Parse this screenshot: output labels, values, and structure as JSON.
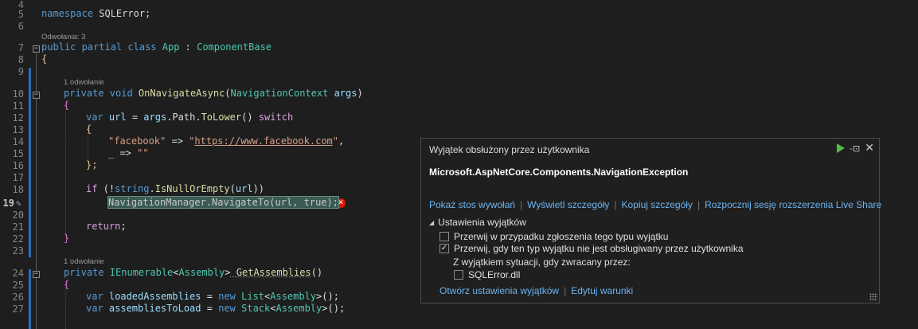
{
  "editor": {
    "line_numbers": [
      "4",
      "5",
      "6",
      "7",
      "8",
      "9",
      "10",
      "11",
      "12",
      "13",
      "14",
      "15",
      "16",
      "17",
      "18",
      "19",
      "20",
      "21",
      "22",
      "23",
      "24",
      "25",
      "26",
      "27"
    ],
    "lens_refs_3": "Odwołania: 3",
    "lens_ref_1a": "1 odwołanie",
    "lens_ref_1b": "1 odwołanie",
    "l5": {
      "kw": "namespace",
      "name": " SQLError;"
    },
    "l7": {
      "kw1": "public",
      "kw2": " partial",
      "kw3": " class",
      "type": " App",
      "sep": " : ",
      "base": "ComponentBase"
    },
    "l8": "{",
    "l10": {
      "kw1": "private",
      "kw2": " void",
      "fn": " OnNavigateAsync",
      "p1": "(",
      "type": "NavigationContext",
      "arg": " args",
      "p2": ")"
    },
    "l11": "{",
    "l12": {
      "kw": "var",
      "v": " url",
      "eq": " = ",
      "args": "args",
      "dot": ".",
      "path": "Path",
      "dot2": ".",
      "fn": "ToLower",
      "par": "()",
      "sw": " switch"
    },
    "l13": "{",
    "l14": {
      "s1": "\"facebook\"",
      "arrow": " => ",
      "q1": "\"",
      "url": "https://www.facebook.com",
      "q2": "\"",
      "comma": ","
    },
    "l15": {
      "disc": "_",
      "arrow": " => ",
      "s": "\"\""
    },
    "l16": "};",
    "l18": {
      "kw": "if",
      "p": " (!",
      "kw2": "string",
      "dot": ".",
      "fn": "IsNullOrEmpty",
      "p2": "(",
      "v": "url",
      "p3": "))"
    },
    "l19": "NavigationManager.NavigateTo(url, true);",
    "l21": {
      "kw": "return",
      "semi": ";"
    },
    "l22": "}",
    "l24": {
      "kw": "private",
      "type": " IEnumerable",
      "lt": "<",
      "t2": "Assembly",
      "gt": ">",
      "fn": " GetAssemblies",
      "par": "()"
    },
    "l25": "{",
    "l26": {
      "kw": "var",
      "v": " loadedAssemblies",
      "eq": " = ",
      "new": "new",
      "type": " List",
      "lt": "<",
      "t2": "Assembly",
      "gt": ">",
      "par": "();"
    },
    "l27": {
      "kw": "var",
      "v": " assembliesToLoad",
      "eq": " = ",
      "new": "new",
      "type": " Stack",
      "lt": "<",
      "t2": "Assembly",
      "gt": ">",
      "par": "();"
    }
  },
  "popup": {
    "title": "Wyjątek obsłużony przez użytkownika",
    "exception": "Microsoft.AspNetCore.Components.NavigationException",
    "links": [
      "Pokaż stos wywołań",
      "Wyświetl szczegóły",
      "Kopiuj szczegóły",
      "Rozpocznij sesję rozszerzenia Live Share"
    ],
    "section": "Ustawienia wyjątków",
    "opt1": {
      "label": "Przerwij w przypadku zgłoszenia tego typu wyjątku",
      "checked": false
    },
    "opt2": {
      "label": "Przerwij, gdy ten typ wyjątku nie jest obsługiwany przez użytkownika",
      "checked": true
    },
    "except_label": "Z wyjątkiem sytuacji, gdy zwracany przez:",
    "opt3": {
      "label": "SQLError.dll",
      "checked": false
    },
    "bottom_links": [
      "Otwórz ustawienia wyjątków",
      "Edytuj warunki"
    ],
    "colors": {
      "link": "#6cb4f0",
      "play": "#55b94a",
      "error": "#e51400"
    }
  }
}
